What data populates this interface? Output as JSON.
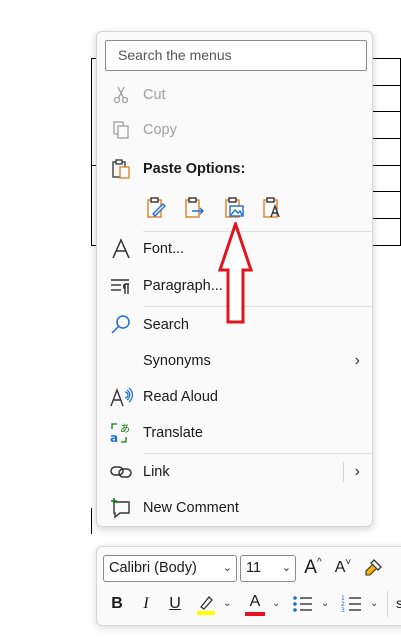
{
  "menu": {
    "search_placeholder": "Search the menus",
    "cut": "Cut",
    "copy": "Copy",
    "paste_options": "Paste Options:",
    "font": "Font...",
    "paragraph": "Paragraph...",
    "search": "Search",
    "synonyms": "Synonyms",
    "read_aloud": "Read Aloud",
    "translate": "Translate",
    "link": "Link",
    "new_comment": "New Comment",
    "submenu_chevron": "›"
  },
  "toolbar": {
    "font_name": "Calibri (Body)",
    "font_size": "11",
    "grow_font": "A",
    "shrink_font": "A",
    "bold": "B",
    "italic": "I",
    "underline": "U",
    "font_color_letter": "A",
    "dropdown_arrow": "⌄",
    "styles_partial": "s"
  },
  "colors": {
    "highlight": "#ffff00",
    "font_color": "#e81123",
    "accent_orange": "#d9822b",
    "accent_blue": "#1f6fd0",
    "annotation_red": "#e0141c"
  }
}
